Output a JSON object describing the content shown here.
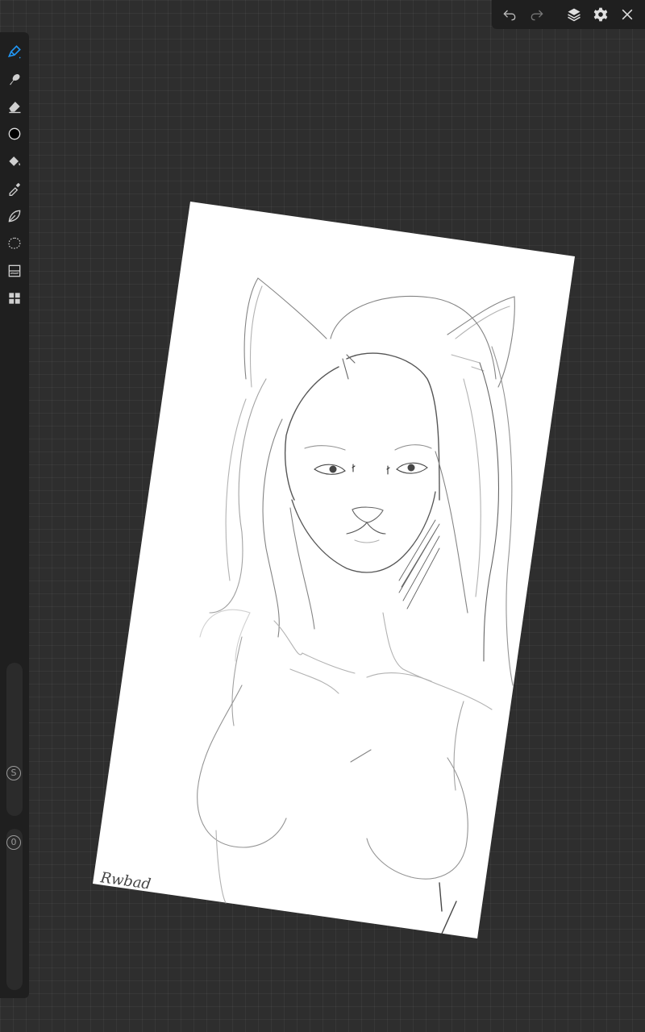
{
  "toolbar_left": {
    "tools": [
      {
        "icon": "brush-pen-icon",
        "active": true
      },
      {
        "icon": "smudge-icon"
      },
      {
        "icon": "eraser-icon"
      },
      {
        "icon": "color-circle-icon",
        "color": "#000000"
      },
      {
        "icon": "paint-bucket-icon"
      },
      {
        "icon": "eyedropper-icon"
      },
      {
        "icon": "shape-lasso-icon"
      },
      {
        "icon": "selection-icon"
      },
      {
        "icon": "adjustments-icon"
      },
      {
        "icon": "gallery-grid-icon"
      }
    ],
    "size_slider_label": "S",
    "opacity_slider_label": "0"
  },
  "toolbar_top": {
    "buttons": [
      "undo-icon",
      "redo-icon",
      "layers-icon",
      "settings-icon",
      "close-icon"
    ]
  },
  "canvas": {
    "signature": "Rwbad",
    "paper_color": "#ffffff",
    "background_color": "#2e2e2e",
    "accent_color": "#2196f3"
  }
}
